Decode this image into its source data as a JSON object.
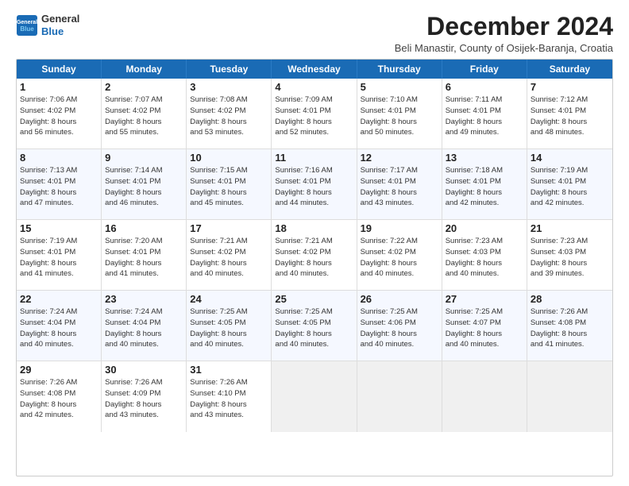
{
  "logo": {
    "general": "General",
    "blue": "Blue"
  },
  "header": {
    "month_title": "December 2024",
    "subtitle": "Beli Manastir, County of Osijek-Baranja, Croatia"
  },
  "weekdays": [
    "Sunday",
    "Monday",
    "Tuesday",
    "Wednesday",
    "Thursday",
    "Friday",
    "Saturday"
  ],
  "rows": [
    [
      {
        "day": "1",
        "info": "Sunrise: 7:06 AM\nSunset: 4:02 PM\nDaylight: 8 hours\nand 56 minutes."
      },
      {
        "day": "2",
        "info": "Sunrise: 7:07 AM\nSunset: 4:02 PM\nDaylight: 8 hours\nand 55 minutes."
      },
      {
        "day": "3",
        "info": "Sunrise: 7:08 AM\nSunset: 4:02 PM\nDaylight: 8 hours\nand 53 minutes."
      },
      {
        "day": "4",
        "info": "Sunrise: 7:09 AM\nSunset: 4:01 PM\nDaylight: 8 hours\nand 52 minutes."
      },
      {
        "day": "5",
        "info": "Sunrise: 7:10 AM\nSunset: 4:01 PM\nDaylight: 8 hours\nand 50 minutes."
      },
      {
        "day": "6",
        "info": "Sunrise: 7:11 AM\nSunset: 4:01 PM\nDaylight: 8 hours\nand 49 minutes."
      },
      {
        "day": "7",
        "info": "Sunrise: 7:12 AM\nSunset: 4:01 PM\nDaylight: 8 hours\nand 48 minutes."
      }
    ],
    [
      {
        "day": "8",
        "info": "Sunrise: 7:13 AM\nSunset: 4:01 PM\nDaylight: 8 hours\nand 47 minutes."
      },
      {
        "day": "9",
        "info": "Sunrise: 7:14 AM\nSunset: 4:01 PM\nDaylight: 8 hours\nand 46 minutes."
      },
      {
        "day": "10",
        "info": "Sunrise: 7:15 AM\nSunset: 4:01 PM\nDaylight: 8 hours\nand 45 minutes."
      },
      {
        "day": "11",
        "info": "Sunrise: 7:16 AM\nSunset: 4:01 PM\nDaylight: 8 hours\nand 44 minutes."
      },
      {
        "day": "12",
        "info": "Sunrise: 7:17 AM\nSunset: 4:01 PM\nDaylight: 8 hours\nand 43 minutes."
      },
      {
        "day": "13",
        "info": "Sunrise: 7:18 AM\nSunset: 4:01 PM\nDaylight: 8 hours\nand 42 minutes."
      },
      {
        "day": "14",
        "info": "Sunrise: 7:19 AM\nSunset: 4:01 PM\nDaylight: 8 hours\nand 42 minutes."
      }
    ],
    [
      {
        "day": "15",
        "info": "Sunrise: 7:19 AM\nSunset: 4:01 PM\nDaylight: 8 hours\nand 41 minutes."
      },
      {
        "day": "16",
        "info": "Sunrise: 7:20 AM\nSunset: 4:01 PM\nDaylight: 8 hours\nand 41 minutes."
      },
      {
        "day": "17",
        "info": "Sunrise: 7:21 AM\nSunset: 4:02 PM\nDaylight: 8 hours\nand 40 minutes."
      },
      {
        "day": "18",
        "info": "Sunrise: 7:21 AM\nSunset: 4:02 PM\nDaylight: 8 hours\nand 40 minutes."
      },
      {
        "day": "19",
        "info": "Sunrise: 7:22 AM\nSunset: 4:02 PM\nDaylight: 8 hours\nand 40 minutes."
      },
      {
        "day": "20",
        "info": "Sunrise: 7:23 AM\nSunset: 4:03 PM\nDaylight: 8 hours\nand 40 minutes."
      },
      {
        "day": "21",
        "info": "Sunrise: 7:23 AM\nSunset: 4:03 PM\nDaylight: 8 hours\nand 39 minutes."
      }
    ],
    [
      {
        "day": "22",
        "info": "Sunrise: 7:24 AM\nSunset: 4:04 PM\nDaylight: 8 hours\nand 40 minutes."
      },
      {
        "day": "23",
        "info": "Sunrise: 7:24 AM\nSunset: 4:04 PM\nDaylight: 8 hours\nand 40 minutes."
      },
      {
        "day": "24",
        "info": "Sunrise: 7:25 AM\nSunset: 4:05 PM\nDaylight: 8 hours\nand 40 minutes."
      },
      {
        "day": "25",
        "info": "Sunrise: 7:25 AM\nSunset: 4:05 PM\nDaylight: 8 hours\nand 40 minutes."
      },
      {
        "day": "26",
        "info": "Sunrise: 7:25 AM\nSunset: 4:06 PM\nDaylight: 8 hours\nand 40 minutes."
      },
      {
        "day": "27",
        "info": "Sunrise: 7:25 AM\nSunset: 4:07 PM\nDaylight: 8 hours\nand 40 minutes."
      },
      {
        "day": "28",
        "info": "Sunrise: 7:26 AM\nSunset: 4:08 PM\nDaylight: 8 hours\nand 41 minutes."
      }
    ],
    [
      {
        "day": "29",
        "info": "Sunrise: 7:26 AM\nSunset: 4:08 PM\nDaylight: 8 hours\nand 42 minutes."
      },
      {
        "day": "30",
        "info": "Sunrise: 7:26 AM\nSunset: 4:09 PM\nDaylight: 8 hours\nand 43 minutes."
      },
      {
        "day": "31",
        "info": "Sunrise: 7:26 AM\nSunset: 4:10 PM\nDaylight: 8 hours\nand 43 minutes."
      },
      {
        "day": "",
        "info": ""
      },
      {
        "day": "",
        "info": ""
      },
      {
        "day": "",
        "info": ""
      },
      {
        "day": "",
        "info": ""
      }
    ]
  ]
}
